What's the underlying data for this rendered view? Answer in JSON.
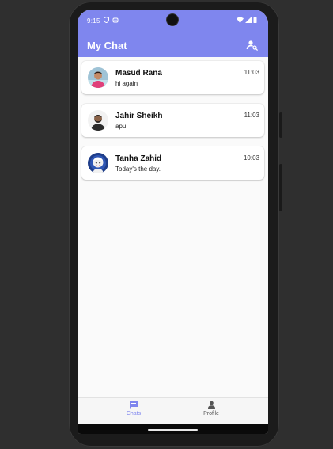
{
  "status": {
    "time": "9:15"
  },
  "appbar": {
    "title": "My Chat",
    "action_icon": "person-search-icon"
  },
  "chats": [
    {
      "name": "Masud Rana",
      "message": "hi again",
      "time": "11:03"
    },
    {
      "name": "Jahir Sheikh",
      "message": "apu",
      "time": "11:03"
    },
    {
      "name": "Tanha Zahid",
      "message": "Today's the day.",
      "time": "10:03"
    }
  ],
  "bottom_nav": {
    "chats_label": "Chats",
    "profile_label": "Profile"
  },
  "colors": {
    "primary": "#7f86ee",
    "background": "#fafafa",
    "phone_frame": "#1b1b1b"
  }
}
